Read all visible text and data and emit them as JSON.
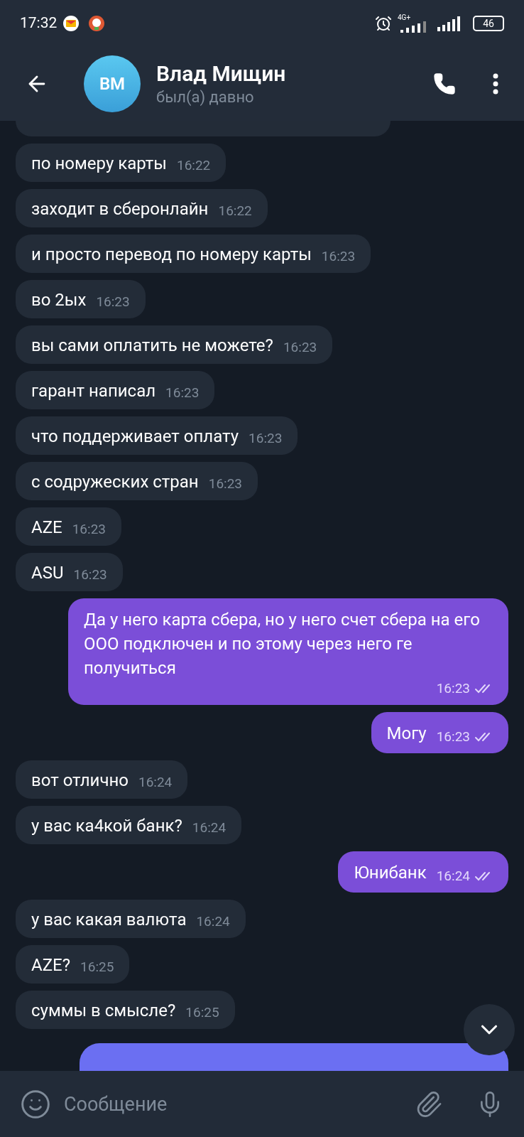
{
  "status_bar": {
    "time": "17:32",
    "network": "4G+",
    "battery": "46"
  },
  "header": {
    "avatar_initials": "ВМ",
    "name": "Влад Мищин",
    "status": "был(а) давно"
  },
  "messages": [
    {
      "kind": "in",
      "text": "по номеру карты",
      "time": "16:22"
    },
    {
      "kind": "in",
      "text": "заходит в сберонлайн",
      "time": "16:22"
    },
    {
      "kind": "in",
      "text": "и просто перевод по номеру карты",
      "time": "16:23"
    },
    {
      "kind": "in",
      "text": "во 2ых",
      "time": "16:23"
    },
    {
      "kind": "in",
      "text": "вы сами оплатить не можете?",
      "time": "16:23"
    },
    {
      "kind": "in",
      "text": "гарант написал",
      "time": "16:23"
    },
    {
      "kind": "in",
      "text": "что поддерживает оплату",
      "time": "16:23"
    },
    {
      "kind": "in",
      "text": "с содружеских стран",
      "time": "16:23"
    },
    {
      "kind": "in",
      "text": "AZE",
      "time": "16:23"
    },
    {
      "kind": "in",
      "text": "ASU",
      "time": "16:23"
    },
    {
      "kind": "out",
      "text": "Да у него карта сбера, но у него счет сбера на его ООО подключен и по этому через него ге получиться",
      "time": "16:23",
      "read": true
    },
    {
      "kind": "out",
      "text": "Могу",
      "time": "16:23",
      "read": true
    },
    {
      "kind": "in",
      "text": "вот отлично",
      "time": "16:24"
    },
    {
      "kind": "in",
      "text": "у вас ка4кой банк?",
      "time": "16:24"
    },
    {
      "kind": "out",
      "text": "Юнибанк",
      "time": "16:24",
      "read": true
    },
    {
      "kind": "in",
      "text": "у вас какая валюта",
      "time": "16:24"
    },
    {
      "kind": "in",
      "text": "AZE?",
      "time": "16:25"
    },
    {
      "kind": "in",
      "text": "суммы в смысле?",
      "time": "16:25"
    }
  ],
  "composer": {
    "placeholder": "Сообщение"
  }
}
